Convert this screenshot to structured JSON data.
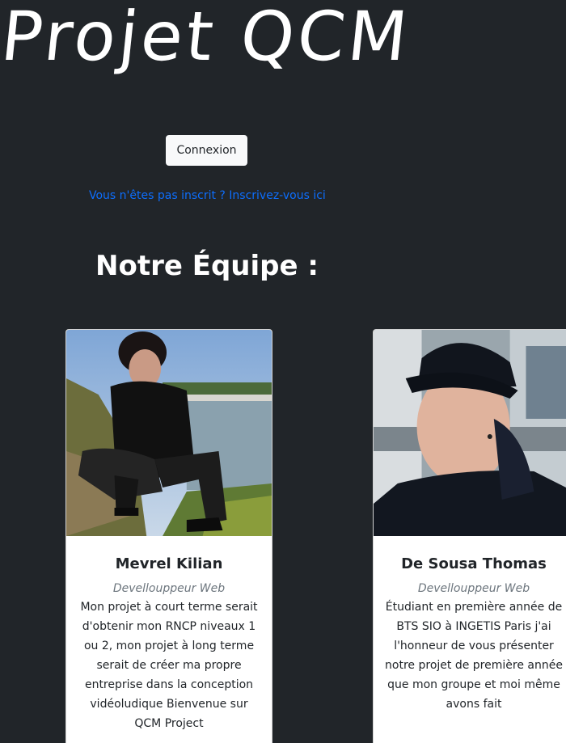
{
  "header": {
    "title": "Projet QCM"
  },
  "auth": {
    "login_label": "Connexion",
    "register_link": "Vous n'êtes pas inscrit ? Inscrivez-vous ici"
  },
  "team": {
    "heading": "Notre Équipe :",
    "members": [
      {
        "name": "Mevrel Kilian",
        "role": "Devellouppeur Web",
        "bio": "Mon projet à court terme serait d'obtenir mon RNCP niveaux 1 ou 2, mon projet à long terme serait de créer ma propre entreprise dans la conception vidéoludique Bienvenue sur QCM Project"
      },
      {
        "name": "De Sousa Thomas",
        "role": "Devellouppeur Web",
        "bio": "Étudiant en première année de BTS SIO à INGETIS Paris j'ai l'honneur de vous présenter notre projet de première année que mon groupe et moi même avons fait"
      }
    ]
  },
  "colors": {
    "background": "#212529",
    "link": "#0d6efd",
    "button_bg": "#f8f9fa",
    "card_bg": "#ffffff"
  }
}
